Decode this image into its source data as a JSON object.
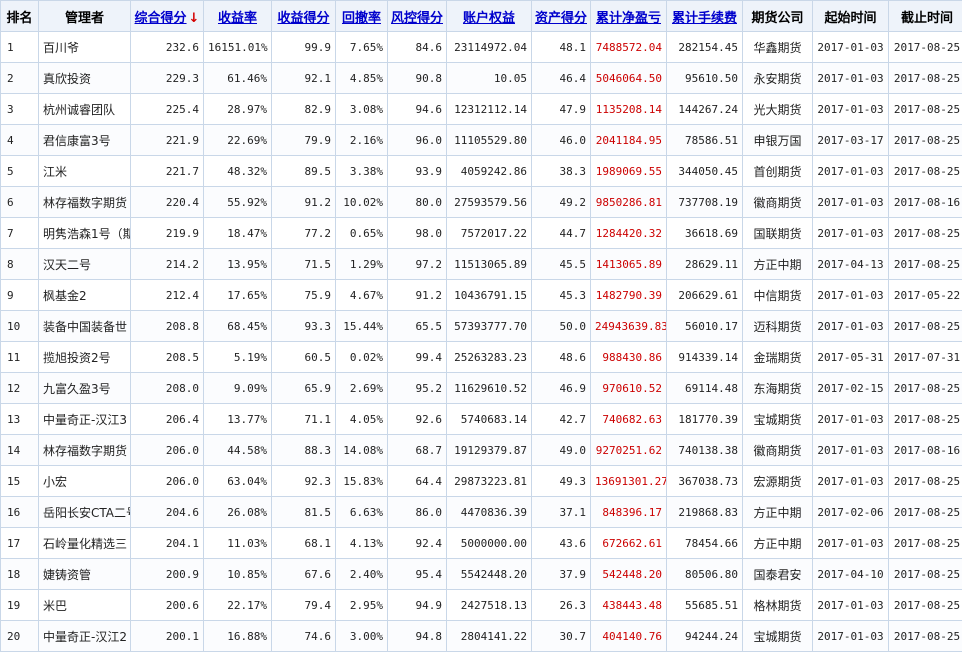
{
  "headers": {
    "rank": "排名",
    "manager": "管理者",
    "composite": "综合得分",
    "return_rate": "收益率",
    "return_score": "收益得分",
    "drawdown": "回撤率",
    "risk_score": "风控得分",
    "equity": "账户权益",
    "asset_score": "资产得分",
    "cum_pnl": "累计净盈亏",
    "cum_fee": "累计手续费",
    "broker": "期货公司",
    "start": "起始时间",
    "end": "截止时间"
  },
  "sort_indicator": "↓",
  "accent_colors": {
    "link": "#0000cc",
    "pnl": "#cc0000",
    "header_bg": "#eef3fa",
    "border": "#c9d7e8"
  },
  "rows": [
    {
      "rank": "1",
      "manager": "百川爷",
      "composite": "232.6",
      "return_rate": "16151.01%",
      "return_score": "99.9",
      "drawdown": "7.65%",
      "risk_score": "84.6",
      "equity": "23114972.04",
      "asset_score": "48.1",
      "cum_pnl": "7488572.04",
      "cum_fee": "282154.45",
      "broker": "华鑫期货",
      "start": "2017-01-03",
      "end": "2017-08-25"
    },
    {
      "rank": "2",
      "manager": "真欣投资",
      "composite": "229.3",
      "return_rate": "61.46%",
      "return_score": "92.1",
      "drawdown": "4.85%",
      "risk_score": "90.8",
      "equity": "10.05",
      "asset_score": "46.4",
      "cum_pnl": "5046064.50",
      "cum_fee": "95610.50",
      "broker": "永安期货",
      "start": "2017-01-03",
      "end": "2017-08-25"
    },
    {
      "rank": "3",
      "manager": "杭州诚睿团队",
      "composite": "225.4",
      "return_rate": "28.97%",
      "return_score": "82.9",
      "drawdown": "3.08%",
      "risk_score": "94.6",
      "equity": "12312112.14",
      "asset_score": "47.9",
      "cum_pnl": "1135208.14",
      "cum_fee": "144267.24",
      "broker": "光大期货",
      "start": "2017-01-03",
      "end": "2017-08-25"
    },
    {
      "rank": "4",
      "manager": "君信康富3号",
      "composite": "221.9",
      "return_rate": "22.69%",
      "return_score": "79.9",
      "drawdown": "2.16%",
      "risk_score": "96.0",
      "equity": "11105529.80",
      "asset_score": "46.0",
      "cum_pnl": "2041184.95",
      "cum_fee": "78586.51",
      "broker": "申银万国",
      "start": "2017-03-17",
      "end": "2017-08-25"
    },
    {
      "rank": "5",
      "manager": "江米",
      "composite": "221.7",
      "return_rate": "48.32%",
      "return_score": "89.5",
      "drawdown": "3.38%",
      "risk_score": "93.9",
      "equity": "4059242.86",
      "asset_score": "38.3",
      "cum_pnl": "1989069.55",
      "cum_fee": "344050.45",
      "broker": "首创期货",
      "start": "2017-01-03",
      "end": "2017-08-25"
    },
    {
      "rank": "6",
      "manager": "林存福数字期货",
      "composite": "220.4",
      "return_rate": "55.92%",
      "return_score": "91.2",
      "drawdown": "10.02%",
      "risk_score": "80.0",
      "equity": "27593579.56",
      "asset_score": "49.2",
      "cum_pnl": "9850286.81",
      "cum_fee": "737708.19",
      "broker": "徽商期货",
      "start": "2017-01-03",
      "end": "2017-08-16"
    },
    {
      "rank": "7",
      "manager": "明隽浩森1号（期",
      "composite": "219.9",
      "return_rate": "18.47%",
      "return_score": "77.2",
      "drawdown": "0.65%",
      "risk_score": "98.0",
      "equity": "7572017.22",
      "asset_score": "44.7",
      "cum_pnl": "1284420.32",
      "cum_fee": "36618.69",
      "broker": "国联期货",
      "start": "2017-01-03",
      "end": "2017-08-25"
    },
    {
      "rank": "8",
      "manager": "汉天二号",
      "composite": "214.2",
      "return_rate": "13.95%",
      "return_score": "71.5",
      "drawdown": "1.29%",
      "risk_score": "97.2",
      "equity": "11513065.89",
      "asset_score": "45.5",
      "cum_pnl": "1413065.89",
      "cum_fee": "28629.11",
      "broker": "方正中期",
      "start": "2017-04-13",
      "end": "2017-08-25"
    },
    {
      "rank": "9",
      "manager": "枫基金2",
      "composite": "212.4",
      "return_rate": "17.65%",
      "return_score": "75.9",
      "drawdown": "4.67%",
      "risk_score": "91.2",
      "equity": "10436791.15",
      "asset_score": "45.3",
      "cum_pnl": "1482790.39",
      "cum_fee": "206629.61",
      "broker": "中信期货",
      "start": "2017-01-03",
      "end": "2017-05-22"
    },
    {
      "rank": "10",
      "manager": "装备中国装备世",
      "composite": "208.8",
      "return_rate": "68.45%",
      "return_score": "93.3",
      "drawdown": "15.44%",
      "risk_score": "65.5",
      "equity": "57393777.70",
      "asset_score": "50.0",
      "cum_pnl": "24943639.83",
      "cum_fee": "56010.17",
      "broker": "迈科期货",
      "start": "2017-01-03",
      "end": "2017-08-25"
    },
    {
      "rank": "11",
      "manager": "揽旭投资2号",
      "composite": "208.5",
      "return_rate": "5.19%",
      "return_score": "60.5",
      "drawdown": "0.02%",
      "risk_score": "99.4",
      "equity": "25263283.23",
      "asset_score": "48.6",
      "cum_pnl": "988430.86",
      "cum_fee": "914339.14",
      "broker": "金瑞期货",
      "start": "2017-05-31",
      "end": "2017-07-31"
    },
    {
      "rank": "12",
      "manager": "九富久盈3号",
      "composite": "208.0",
      "return_rate": "9.09%",
      "return_score": "65.9",
      "drawdown": "2.69%",
      "risk_score": "95.2",
      "equity": "11629610.52",
      "asset_score": "46.9",
      "cum_pnl": "970610.52",
      "cum_fee": "69114.48",
      "broker": "东海期货",
      "start": "2017-02-15",
      "end": "2017-08-25"
    },
    {
      "rank": "13",
      "manager": "中量奇正-汉江3",
      "composite": "206.4",
      "return_rate": "13.77%",
      "return_score": "71.1",
      "drawdown": "4.05%",
      "risk_score": "92.6",
      "equity": "5740683.14",
      "asset_score": "42.7",
      "cum_pnl": "740682.63",
      "cum_fee": "181770.39",
      "broker": "宝城期货",
      "start": "2017-01-03",
      "end": "2017-08-25"
    },
    {
      "rank": "14",
      "manager": "林存福数字期货",
      "composite": "206.0",
      "return_rate": "44.58%",
      "return_score": "88.3",
      "drawdown": "14.08%",
      "risk_score": "68.7",
      "equity": "19129379.87",
      "asset_score": "49.0",
      "cum_pnl": "9270251.62",
      "cum_fee": "740138.38",
      "broker": "徽商期货",
      "start": "2017-01-03",
      "end": "2017-08-16"
    },
    {
      "rank": "15",
      "manager": "小宏",
      "composite": "206.0",
      "return_rate": "63.04%",
      "return_score": "92.3",
      "drawdown": "15.83%",
      "risk_score": "64.4",
      "equity": "29873223.81",
      "asset_score": "49.3",
      "cum_pnl": "13691301.27",
      "cum_fee": "367038.73",
      "broker": "宏源期货",
      "start": "2017-01-03",
      "end": "2017-08-25"
    },
    {
      "rank": "16",
      "manager": "岳阳长安CTA二号",
      "composite": "204.6",
      "return_rate": "26.08%",
      "return_score": "81.5",
      "drawdown": "6.63%",
      "risk_score": "86.0",
      "equity": "4470836.39",
      "asset_score": "37.1",
      "cum_pnl": "848396.17",
      "cum_fee": "219868.83",
      "broker": "方正中期",
      "start": "2017-02-06",
      "end": "2017-08-25"
    },
    {
      "rank": "17",
      "manager": "石岭量化精选三",
      "composite": "204.1",
      "return_rate": "11.03%",
      "return_score": "68.1",
      "drawdown": "4.13%",
      "risk_score": "92.4",
      "equity": "5000000.00",
      "asset_score": "43.6",
      "cum_pnl": "672662.61",
      "cum_fee": "78454.66",
      "broker": "方正中期",
      "start": "2017-01-03",
      "end": "2017-08-25"
    },
    {
      "rank": "18",
      "manager": "婕铸资管",
      "composite": "200.9",
      "return_rate": "10.85%",
      "return_score": "67.6",
      "drawdown": "2.40%",
      "risk_score": "95.4",
      "equity": "5542448.20",
      "asset_score": "37.9",
      "cum_pnl": "542448.20",
      "cum_fee": "80506.80",
      "broker": "国泰君安",
      "start": "2017-04-10",
      "end": "2017-08-25"
    },
    {
      "rank": "19",
      "manager": "米巴",
      "composite": "200.6",
      "return_rate": "22.17%",
      "return_score": "79.4",
      "drawdown": "2.95%",
      "risk_score": "94.9",
      "equity": "2427518.13",
      "asset_score": "26.3",
      "cum_pnl": "438443.48",
      "cum_fee": "55685.51",
      "broker": "格林期货",
      "start": "2017-01-03",
      "end": "2017-08-25"
    },
    {
      "rank": "20",
      "manager": "中量奇正-汉江2",
      "composite": "200.1",
      "return_rate": "16.88%",
      "return_score": "74.6",
      "drawdown": "3.00%",
      "risk_score": "94.8",
      "equity": "2804141.22",
      "asset_score": "30.7",
      "cum_pnl": "404140.76",
      "cum_fee": "94244.24",
      "broker": "宝城期货",
      "start": "2017-01-03",
      "end": "2017-08-25"
    }
  ]
}
